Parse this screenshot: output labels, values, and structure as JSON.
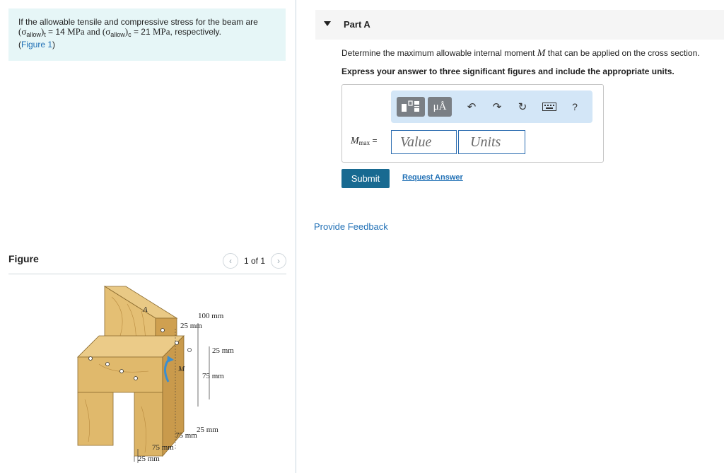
{
  "problem": {
    "text_prefix": "If the allowable tensile and compressive stress for the beam are",
    "sigma": "(σ",
    "allow_t_sub": "allow",
    "t_sub": "t",
    "eq1": " = 14 ",
    "unit1": "MPa",
    "and_text": " and (σ",
    "allow_c_sub": "allow",
    "c_sub": "c",
    "eq2": " = 21 ",
    "unit2": "MPa",
    "respectively": ", respectively.",
    "figure_open": "(",
    "figure_link": "Figure 1",
    "figure_close": ")"
  },
  "figure_panel": {
    "title": "Figure",
    "pager_text": "1 of 1",
    "prev_icon": "chevron-left",
    "next_icon": "chevron-right",
    "labels": {
      "A": "A",
      "M": "M",
      "dim_100": "100 mm",
      "dim_25_top": "25 mm",
      "dim_25_right": "25 mm",
      "dim_75_right": "75 mm",
      "dim_25_bottom": "25 mm",
      "dim_75_inner": "75 mm",
      "dim_75_bottom": "75 mm",
      "dim_25_bl": "25 mm"
    }
  },
  "part": {
    "title": "Part A",
    "question_prefix": "Determine the maximum allowable internal moment ",
    "question_var": "M",
    "question_suffix": " that can be applied on the cross section.",
    "instruction": "Express your answer to three significant figures and include the appropriate units."
  },
  "answer": {
    "label_var": "M",
    "label_sub": "max",
    "label_eq": " =",
    "value_placeholder": "Value",
    "units_placeholder": "Units",
    "toolbar": {
      "units_symbol": "μÅ",
      "help": "?"
    }
  },
  "actions": {
    "submit": "Submit",
    "request_answer": "Request Answer",
    "provide_feedback": "Provide Feedback"
  },
  "colors": {
    "problem_bg": "#e6f6f7",
    "submit_bg": "#186a91",
    "link": "#1f6fb5",
    "toolbar_bg": "#d3e6f7",
    "wood_light": "#e6c27a",
    "wood_dark": "#c99a4c"
  }
}
